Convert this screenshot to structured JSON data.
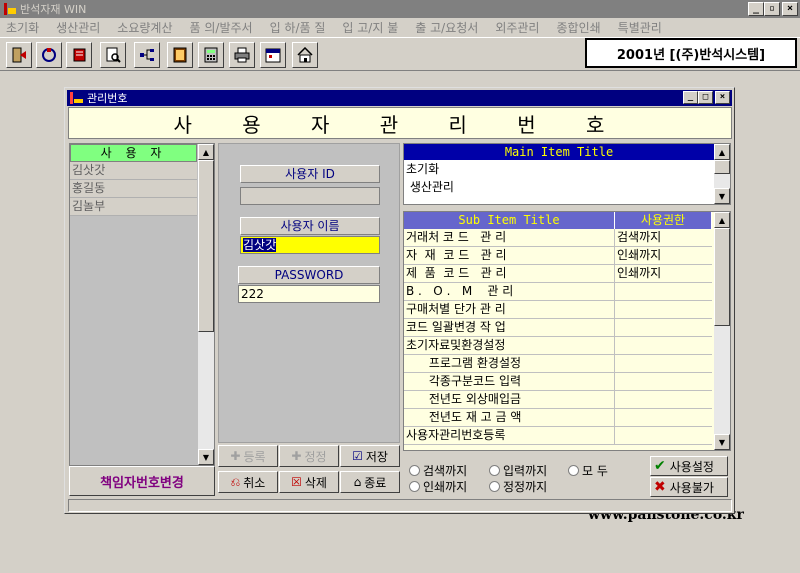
{
  "app": {
    "title": "반석자재 WIN",
    "window_buttons": [
      "_",
      "▫",
      "×"
    ]
  },
  "menu": [
    "초기화",
    "생산관리",
    "소요량계산",
    "품 의/발주서",
    "입 하/품 질",
    "입 고/지 불",
    "출 고/요청서",
    "외주관리",
    "종합인쇄",
    "특별관리"
  ],
  "toolbar": {
    "icons": [
      "exit-icon",
      "refresh-icon",
      "notebook-icon",
      "search-document-icon",
      "network-icon",
      "ledger-icon",
      "calculator-icon",
      "printer-icon",
      "calendar-icon",
      "home-icon"
    ],
    "company": "2001년 [(주)반석시스템]"
  },
  "site_url": "www.panstone.co.kr",
  "dialog": {
    "title": "관리번호",
    "window_buttons": [
      "_",
      "□",
      "×"
    ],
    "banner": "사 용 자 관 리 번 호",
    "users": {
      "header": "사 용 자",
      "rows": [
        "김삿갓",
        "홍길동",
        "김놀부"
      ]
    },
    "change_button": "책임자번호변경",
    "fields": {
      "user_id_label": "사용자 ID",
      "user_id_value": "",
      "user_name_label": "사용자 이름",
      "user_name_value": "김삿갓",
      "password_label": "PASSWORD",
      "password_value": "222"
    },
    "actions": {
      "register": "등록",
      "edit": "정정",
      "save": "저장",
      "cancel": "취소",
      "delete": "삭제",
      "close": "종료"
    },
    "main_items": {
      "header": "Main Item Title",
      "rows": [
        "초기화",
        " 생산관리"
      ]
    },
    "sub_items": {
      "header_title": "Sub Item Title",
      "header_perm": "사용권한",
      "rows": [
        {
          "title": "거래처 코 드   관 리",
          "perm": "검색까지"
        },
        {
          "title": "자  재  코 드   관 리",
          "perm": "인쇄까지"
        },
        {
          "title": "제  품  코 드   관 리",
          "perm": "인쇄까지"
        },
        {
          "title": "B .   O .   M    관 리",
          "perm": ""
        },
        {
          "title": "구매처별 단가 관 리",
          "perm": ""
        },
        {
          "title": "코드 일괄변경 작 업",
          "perm": ""
        },
        {
          "title": "초기자료및환경설정",
          "perm": ""
        },
        {
          "title": "      프로그램 환경설정",
          "perm": ""
        },
        {
          "title": "      각종구분코드 입력",
          "perm": ""
        },
        {
          "title": "      전년도 외상매입금",
          "perm": ""
        },
        {
          "title": "      전년도 재 고 금 액",
          "perm": ""
        },
        {
          "title": "사용자관리번호등록",
          "perm": ""
        }
      ]
    },
    "radios": [
      "검색까지",
      "입력까지",
      "모  두",
      "인쇄까지",
      "정정까지"
    ],
    "perm_buttons": {
      "allow": "사용설정",
      "deny": "사용불가"
    }
  }
}
